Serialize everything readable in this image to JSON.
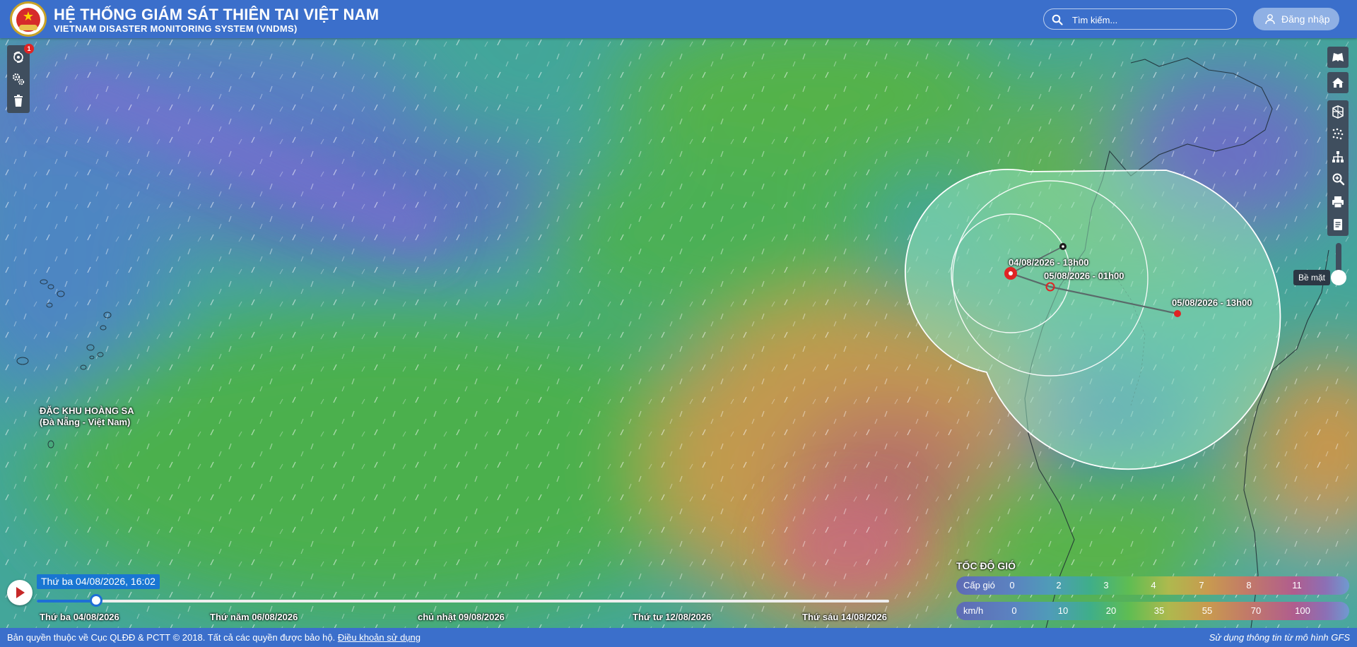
{
  "header": {
    "title": "HỆ THỐNG GIÁM SÁT THIÊN TAI VIỆT NAM",
    "subtitle": "VIETNAM DISASTER MONITORING SYSTEM (VNDMS)",
    "search_placeholder": "Tìm kiếm...",
    "login_label": "Đăng nhập"
  },
  "left_toolbar": {
    "notification_count": "1",
    "items": [
      "typhoon-icon",
      "settings-gears-icon",
      "trash-icon"
    ]
  },
  "right_toolbar": {
    "items": [
      "map-book-icon",
      "home-icon",
      "layers-icon",
      "wind-particles-icon",
      "sitemap-icon",
      "zoom-icon",
      "print-icon",
      "document-icon"
    ],
    "level_tooltip": "Bề mặt"
  },
  "map": {
    "area_label_line1": "ĐẶC KHU HOÀNG SA",
    "area_label_line2": "(Đà Nẵng - Việt Nam)",
    "storm_points": [
      {
        "label": "04/08/2026 - 13h00",
        "type": "current"
      },
      {
        "label": "05/08/2026 - 01h00",
        "type": "forecast"
      },
      {
        "label": "05/08/2026 - 13h00",
        "type": "forecast"
      }
    ]
  },
  "timeline": {
    "current": "Thứ ba 04/08/2026, 16:02",
    "progress": 0.07,
    "dates": [
      "Thứ ba 04/08/2026",
      "Thứ năm 06/08/2026",
      "chủ nhật 09/08/2026",
      "Thứ tư 12/08/2026",
      "Thứ sáu 14/08/2026"
    ]
  },
  "legend": {
    "title": "TỐC ĐỘ GIÓ",
    "row1_label": "Cấp gió",
    "row1_values": [
      "0",
      "2",
      "3",
      "4",
      "7",
      "8",
      "11"
    ],
    "row2_label": "km/h",
    "row2_values": [
      "0",
      "10",
      "20",
      "35",
      "55",
      "70",
      "100"
    ]
  },
  "footer": {
    "copyright": "Bản quyền thuộc về Cục QLĐĐ & PCTT © 2018. Tất cả các quyền được bảo hộ.",
    "terms_link": "Điều khoản sử dụng",
    "source": "Sử dụng thông tin từ mô hình GFS"
  },
  "colors": {
    "header": "#3b6fcb",
    "accent": "#1976d2",
    "cone_fill": "#8fe0b9",
    "storm_red": "#e02424"
  }
}
